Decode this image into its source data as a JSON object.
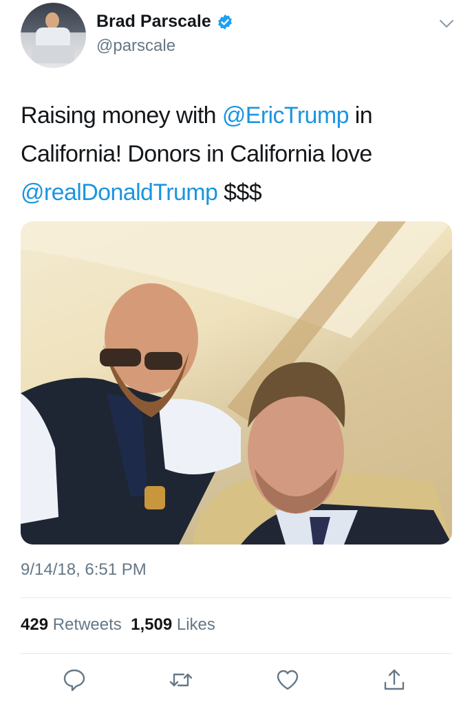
{
  "user": {
    "display_name": "Brad Parscale",
    "handle": "@parscale",
    "verified": true
  },
  "tweet": {
    "segments": [
      {
        "text": "Raising money with ",
        "mention": false
      },
      {
        "text": "@EricTrump",
        "mention": true
      },
      {
        "text": " in California! Donors in California love ",
        "mention": false
      },
      {
        "text": "@realDonaldTrump",
        "mention": true
      },
      {
        "text": " $$$",
        "mention": false
      }
    ],
    "timestamp": "9/14/18, 6:51 PM"
  },
  "stats": {
    "retweets_count": "429",
    "retweets_label": "Retweets",
    "likes_count": "1,509",
    "likes_label": "Likes"
  },
  "actions": [
    {
      "name": "reply-icon"
    },
    {
      "name": "retweet-icon"
    },
    {
      "name": "like-icon"
    },
    {
      "name": "share-icon"
    }
  ],
  "colors": {
    "link": "#1b95e0",
    "secondary_text": "#657786",
    "primary_text": "#14171a",
    "divider": "#e1e8ed"
  }
}
